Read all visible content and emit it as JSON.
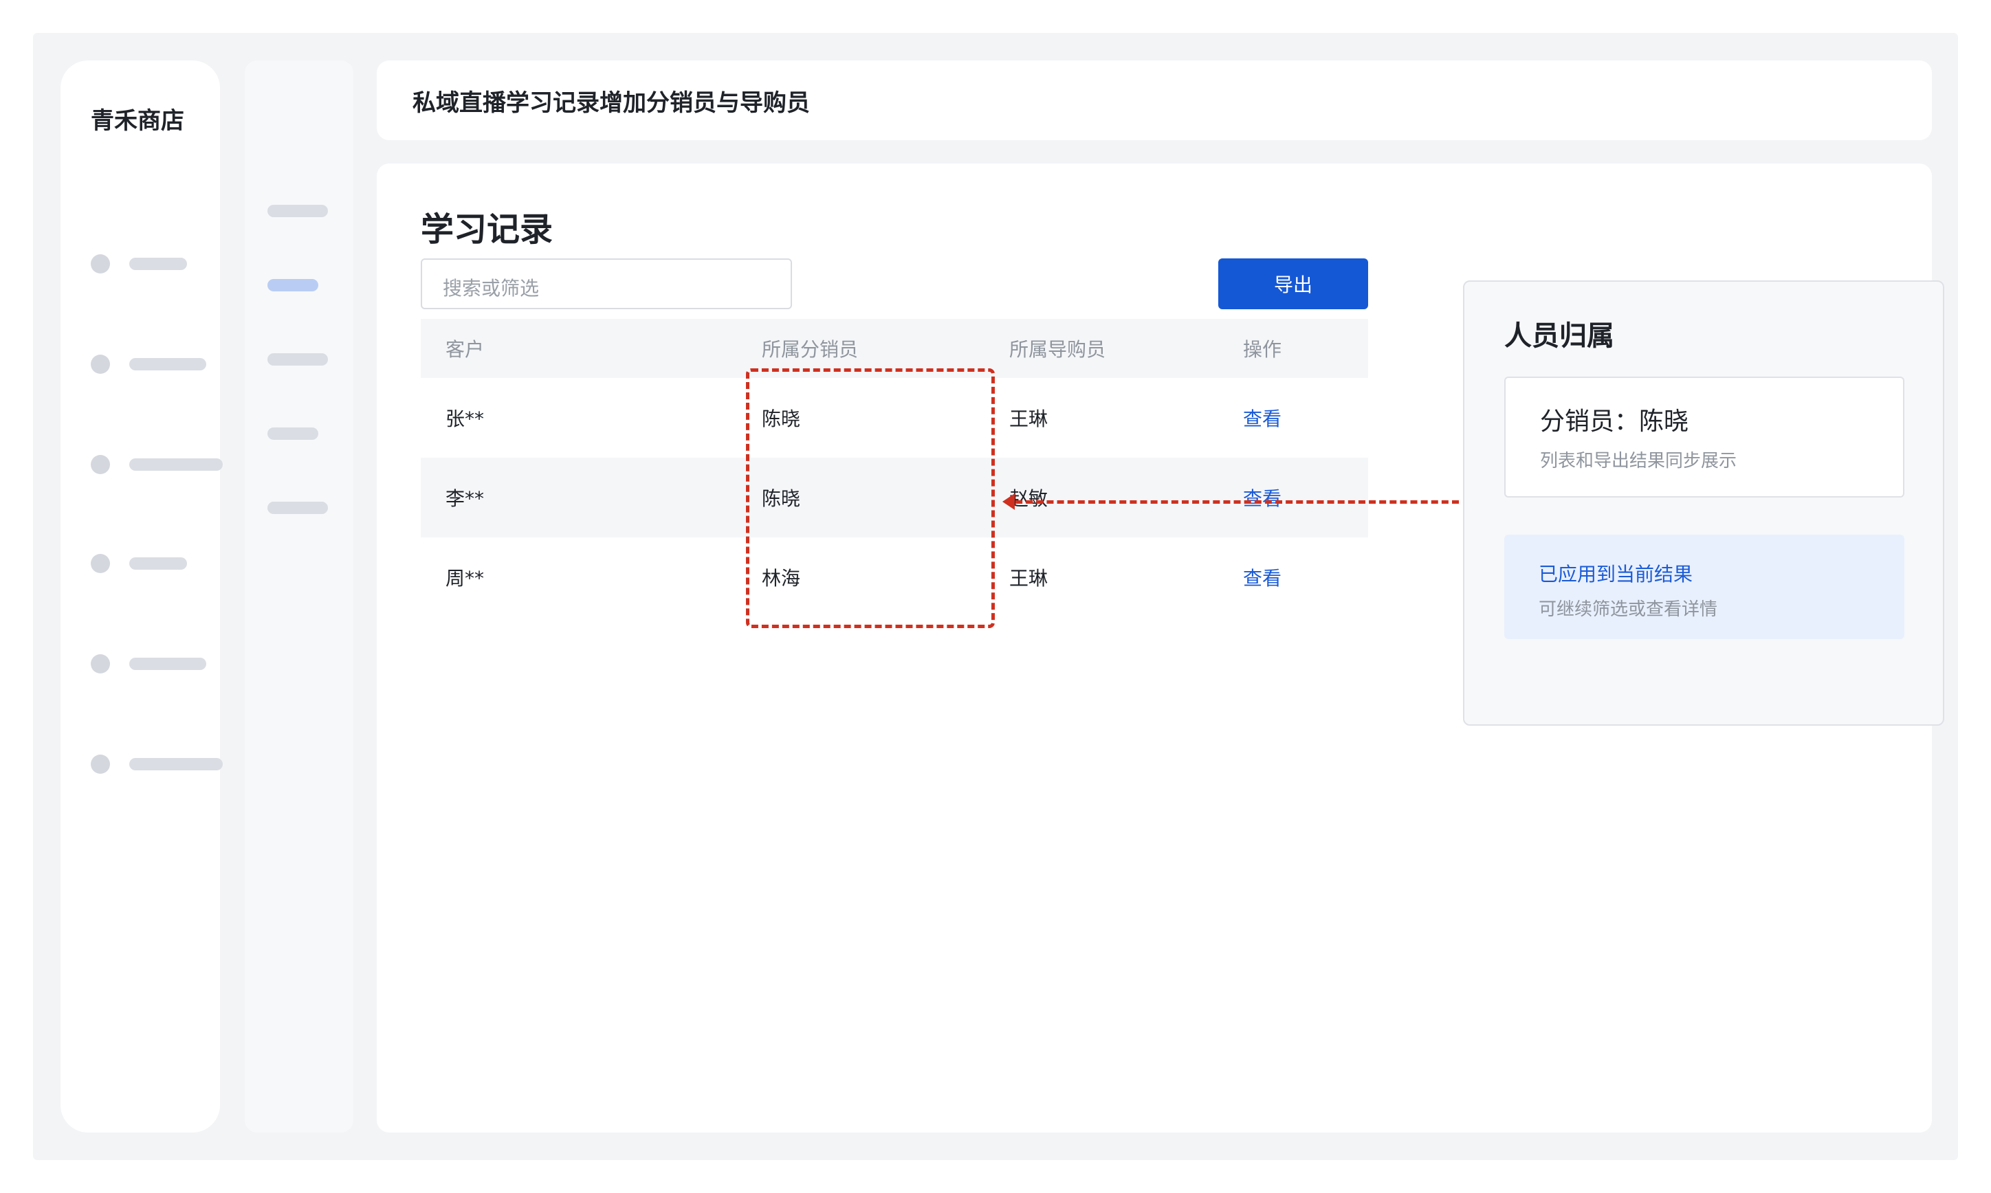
{
  "app": {
    "store_name": "青禾商店"
  },
  "header": {
    "title": "私域直播学习记录增加分销员与导购员"
  },
  "main": {
    "section_title": "学习记录",
    "search": {
      "placeholder": "搜索或筛选"
    },
    "export_label": "导出",
    "table": {
      "columns": [
        "客户",
        "所属分销员",
        "所属导购员",
        "操作"
      ],
      "rows": [
        {
          "customer": "张**",
          "distributor": "陈晓",
          "guide": "王琳",
          "action": "查看"
        },
        {
          "customer": "李**",
          "distributor": "陈晓",
          "guide": "赵敏",
          "action": "查看"
        },
        {
          "customer": "周**",
          "distributor": "林海",
          "guide": "王琳",
          "action": "查看"
        }
      ]
    }
  },
  "panel": {
    "title": "人员归属",
    "attribution": {
      "main": "分销员：陈晓",
      "sub": "列表和导出结果同步展示"
    },
    "applied": {
      "title": "已应用到当前结果",
      "sub": "可继续筛选或查看详情"
    }
  },
  "colors": {
    "primary": "#1558d6",
    "annotation": "#d0301f",
    "link": "#1a5bd6"
  }
}
